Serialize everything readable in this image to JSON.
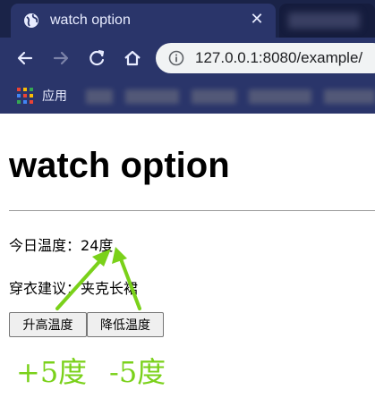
{
  "browser": {
    "tab_title": "watch option",
    "url": "127.0.0.1:8080/example/",
    "bookmarks": {
      "apps_label": "应用"
    },
    "icons": [
      "globe-icon",
      "close-icon",
      "back-icon",
      "forward-icon",
      "reload-icon",
      "home-icon",
      "info-icon",
      "apps-icon"
    ]
  },
  "page": {
    "heading": "watch option",
    "temperature_label": "今日温度：",
    "temperature_value": "24",
    "temperature_unit": "度",
    "advice_label": "穿衣建议：",
    "advice_value": "夹克长裙",
    "buttons": {
      "increase": "升高温度",
      "decrease": "降低温度"
    }
  },
  "annotations": {
    "increase_note": "+5度",
    "decrease_note": "-5度",
    "color": "#7ad11a"
  }
}
